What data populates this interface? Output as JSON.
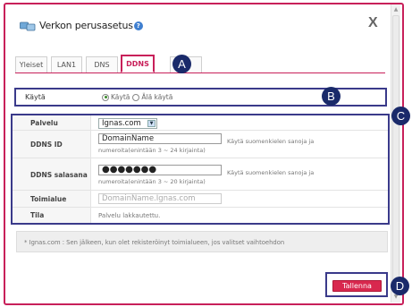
{
  "dialog": {
    "title": "Verkon perusasetus",
    "help_symbol": "?",
    "close_symbol": "X"
  },
  "tabs": [
    {
      "label": "Yleiset"
    },
    {
      "label": "LAN1"
    },
    {
      "label": "DNS"
    },
    {
      "label": "DDNS",
      "active": true
    },
    {
      "label": "..."
    }
  ],
  "badges": {
    "a": "A",
    "b": "B",
    "c": "C",
    "d": "D"
  },
  "enable": {
    "label": "Käytä",
    "option_on": "Käytä",
    "option_off": "Älä käytä",
    "selected": "on"
  },
  "fields": {
    "service_label": "Palvelu",
    "service_value": "Ignas.com",
    "ddns_id_label": "DDNS ID",
    "ddns_id_value": "DomainName",
    "ddns_id_hint1": "Käytä suomenkielen sanoja ja",
    "ddns_id_hint2": "numeroita(enintään 3 ~ 24 kirjainta)",
    "password_label": "DDNS salasana",
    "password_value": "●●●●●●●",
    "password_hint1": "Käytä suomenkielen sanoja ja",
    "password_hint2": "numeroita(enintään 3 ~ 20 kirjainta)",
    "domain_label": "Toimialue",
    "domain_value": "DomainName.Ignas.com",
    "status_label": "Tila",
    "status_value": "Palvelu lakkautettu."
  },
  "info": {
    "text": "* Ignas.com : Sen jälkeen, kun olet rekisteröinyt toimialueen, jos valitset vaihtoehdon"
  },
  "actions": {
    "apply_label": "Tallenna"
  },
  "colors": {
    "accent": "#c8205a",
    "annotation_box": "#3a3a8a",
    "button": "#d8284e"
  }
}
